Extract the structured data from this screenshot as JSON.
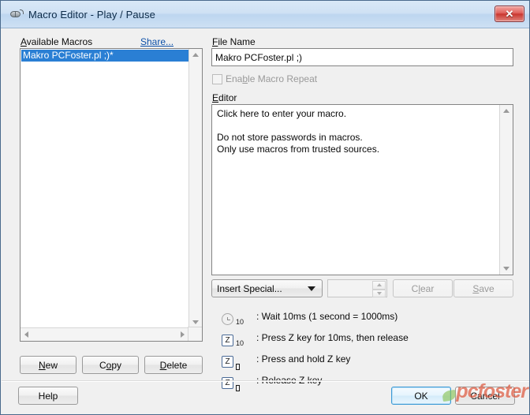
{
  "window": {
    "title": "Macro Editor - Play / Pause",
    "icon": "mouse-icon",
    "close_label": "✕"
  },
  "left_panel": {
    "available_macros_label_pre": "A",
    "available_macros_label_post": "vailable Macros",
    "share_link": "Share...",
    "macros": [
      {
        "name": "Makro PCFoster.pl ;)*",
        "selected": true
      }
    ],
    "buttons": {
      "new": {
        "pre": "",
        "key": "N",
        "post": "ew"
      },
      "copy": {
        "pre": "C",
        "key": "o",
        "post": "py"
      },
      "delete": {
        "pre": "",
        "key": "D",
        "post": "elete"
      }
    }
  },
  "right_panel": {
    "file_name_label_pre": "F",
    "file_name_label_post": "ile Name",
    "file_name_value": "Makro PCFoster.pl ;)",
    "file_name_placeholder": "",
    "enable_repeat": {
      "pre": "Ena",
      "key": "b",
      "post": "le Macro Repeat",
      "checked": false,
      "enabled": false
    },
    "editor_label_pre": "E",
    "editor_label_post": "ditor",
    "editor_text": "Click here to enter your macro.\n\nDo not store passwords in macros.\nOnly use macros from trusted sources.",
    "toolbar": {
      "insert_special": "Insert Special...",
      "spinner_value": "",
      "clear": {
        "pre": "C",
        "key": "l",
        "post": "ear"
      },
      "save": {
        "pre": "",
        "key": "S",
        "post": "ave"
      }
    },
    "legend": [
      {
        "icon": "clock-icon",
        "icon_label": "",
        "sub": "10",
        "sub_is_tofu": false,
        "text": ": Wait 10ms (1 second = 1000ms)"
      },
      {
        "icon": "key-icon",
        "icon_label": "Z",
        "sub": "10",
        "sub_is_tofu": false,
        "text": ": Press Z key for  10ms, then release"
      },
      {
        "icon": "key-icon",
        "icon_label": "Z",
        "sub": "",
        "sub_is_tofu": true,
        "text": ": Press and hold Z key"
      },
      {
        "icon": "key-icon",
        "icon_label": "Z",
        "sub": "",
        "sub_is_tofu": true,
        "text": ": Release Z key"
      }
    ]
  },
  "footer": {
    "help": "Help",
    "ok": "OK",
    "cancel": "Cancel"
  },
  "watermark": {
    "text": "pcfoster"
  },
  "colors": {
    "selection_blue": "#2a7fd4",
    "link_blue": "#0b4fa8",
    "titlebar_blue": "#cfe1f4",
    "dialog_gray": "#f0f0f0",
    "close_red": "#c9362f",
    "watermark_red": "#d63e1e",
    "watermark_green": "#8cc45a",
    "disabled_gray": "#9a9a9a"
  }
}
